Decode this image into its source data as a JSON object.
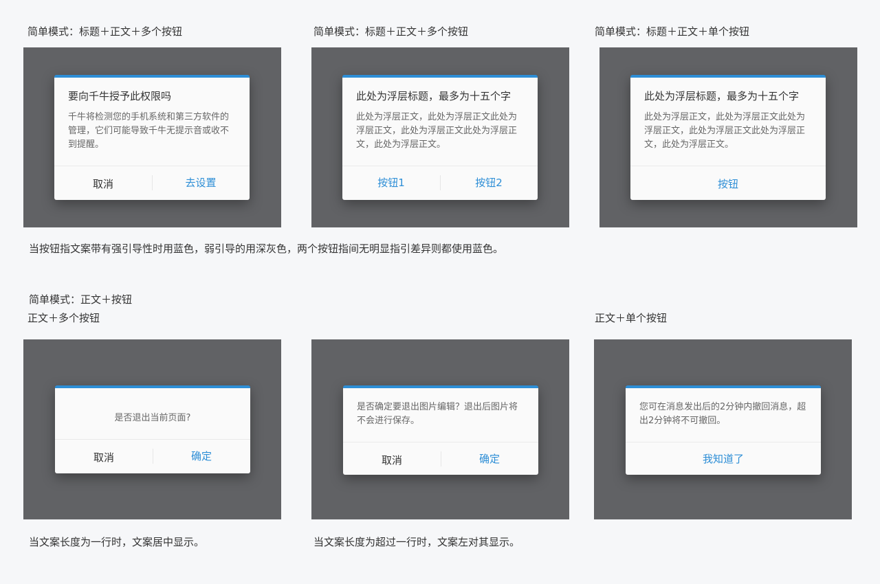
{
  "top_labels": [
    "简单模式：标题＋正文＋多个按钮",
    "简单模式：标题＋正文＋多个按钮",
    "简单模式：标题＋正文＋单个按钮"
  ],
  "dialogs_top": [
    {
      "title": "要向千牛授予此权限吗",
      "body": "千牛将检测您的手机系统和第三方软件的管理，它们可能导致千牛无提示音或收不到提醒。",
      "buttons": [
        "取消",
        "去设置"
      ]
    },
    {
      "title": "此处为浮层标题，最多为十五个字",
      "body": "此处为浮层正文，此处为浮层正文此处为浮层正文，此处为浮层正文此处为浮层正文，此处为浮层正文。",
      "buttons": [
        "按钮1",
        "按钮2"
      ]
    },
    {
      "title": "此处为浮层标题，最多为十五个字",
      "body": "此处为浮层正文，此处为浮层正文此处为浮层正文，此处为浮层正文此处为浮层正文，此处为浮层正文。",
      "buttons": [
        "按钮"
      ]
    }
  ],
  "note_top": "当按钮指文案带有强引导性时用蓝色，弱引导的用深灰色，两个按钮指间无明显指引差异则都使用蓝色。",
  "section2_label": "简单模式：正文＋按钮",
  "bottom_labels": [
    "正文＋多个按钮",
    "正文＋单个按钮"
  ],
  "dialogs_bottom": [
    {
      "body": "是否退出当前页面?",
      "buttons": [
        "取消",
        "确定"
      ]
    },
    {
      "body": "是否确定要退出图片编辑？退出后图片将不会进行保存。",
      "buttons": [
        "取消",
        "确定"
      ]
    },
    {
      "body": "您可在消息发出后的2分钟内撤回消息，超出2分钟将不可撤回。",
      "buttons": [
        "我知道了"
      ]
    }
  ],
  "note_bottom_left": "当文案长度为一行时，文案居中显示。",
  "note_bottom_right": "当文案长度为超过一行时，文案左对其显示。",
  "colors": {
    "page_bg": "#f6f7f9",
    "overlay": "#616265",
    "dialog_bg": "#fafafa",
    "accent_blue": "#2d8ed6",
    "text_dark": "#333333",
    "text_body": "#666666"
  }
}
